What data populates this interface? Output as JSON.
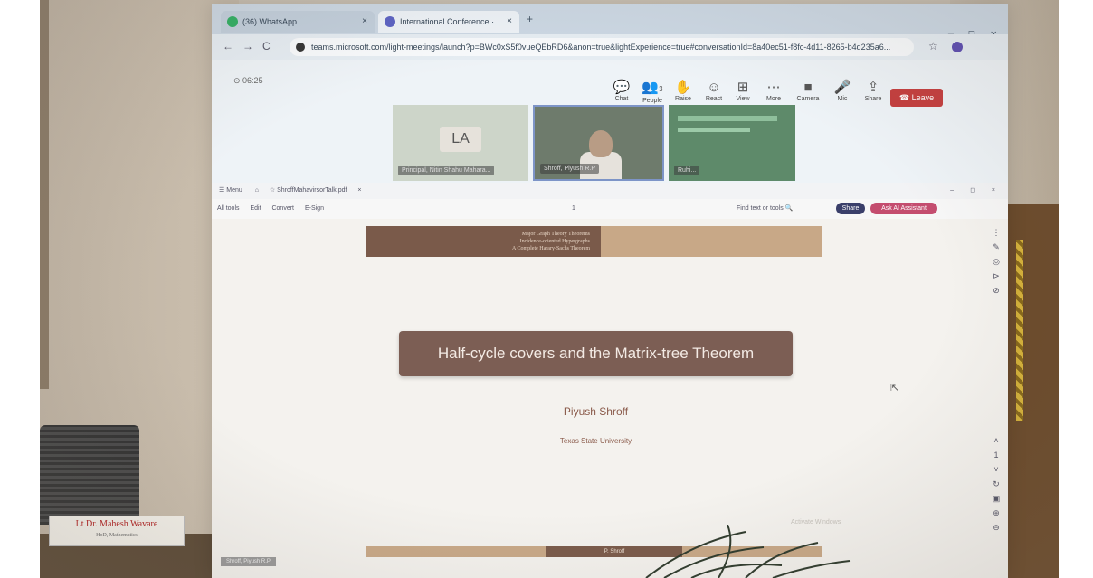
{
  "browser": {
    "tabs": [
      {
        "label": "(36) WhatsApp",
        "icon": "whatsapp-icon"
      },
      {
        "label": "International Conference ·",
        "icon": "teams-icon"
      }
    ],
    "new_tab": "+",
    "url": "teams.microsoft.com/light-meetings/launch?p=BWc0xS5f0vueQEbRD6&anon=true&lightExperience=true#conversationId=8a40ec51-f8fc-4d11-8265-b4d235a6...",
    "window_controls": {
      "min": "–",
      "max": "◻",
      "close": "×"
    },
    "nav": {
      "back": "←",
      "forward": "→",
      "reload": "C"
    }
  },
  "teams": {
    "timer": "06:25",
    "toolbar": [
      {
        "label": "Chat",
        "icon": "chat-icon",
        "glyph": "💬"
      },
      {
        "label": "People",
        "icon": "people-icon",
        "glyph": "👥"
      },
      {
        "label": "Raise",
        "icon": "raise-hand-icon",
        "glyph": "✋"
      },
      {
        "label": "React",
        "icon": "react-icon",
        "glyph": "☺"
      },
      {
        "label": "View",
        "icon": "view-icon",
        "glyph": "⊞"
      },
      {
        "label": "More",
        "icon": "more-icon",
        "glyph": "⋯"
      },
      {
        "label": "Camera",
        "icon": "camera-icon",
        "glyph": "■"
      },
      {
        "label": "Mic",
        "icon": "mic-icon",
        "glyph": "🎤"
      },
      {
        "label": "Share",
        "icon": "share-icon",
        "glyph": "⇪"
      }
    ],
    "people_count": "3",
    "leave_label": "Leave",
    "participants": [
      {
        "initials": "LA",
        "name": "Principal, Nitin Shahu Mahara..."
      },
      {
        "name": "Shroff, Piyush R.P"
      },
      {
        "name": "Ruhi..."
      }
    ]
  },
  "pdf": {
    "tab_title": "Menu",
    "file_tab": "ShroffMahavirsorTalk.pdf",
    "toolbar_items": [
      "All tools",
      "Edit",
      "Convert",
      "E-Sign"
    ],
    "page_indicator": "1",
    "find_label": "Find text or tools",
    "share_label": "Share",
    "ask_label": "Ask AI Assistant"
  },
  "slide": {
    "header_lines": [
      "Major Graph Theory Theorems",
      "Incidence-oriented Hypergraphs",
      "A Complete Harary-Sachs Theorem"
    ],
    "title": "Half-cycle covers and the Matrix-tree Theorem",
    "author": "Piyush Shroff",
    "institution": "Texas State University",
    "footer": "P. Shroff",
    "watermark": "Activate Windows",
    "speaker_label": "Shroff, Piyush R.P"
  },
  "room": {
    "nameplate_title": "Lt Dr. Mahesh Wavare",
    "nameplate_sub": "HoD, Mathematics"
  }
}
